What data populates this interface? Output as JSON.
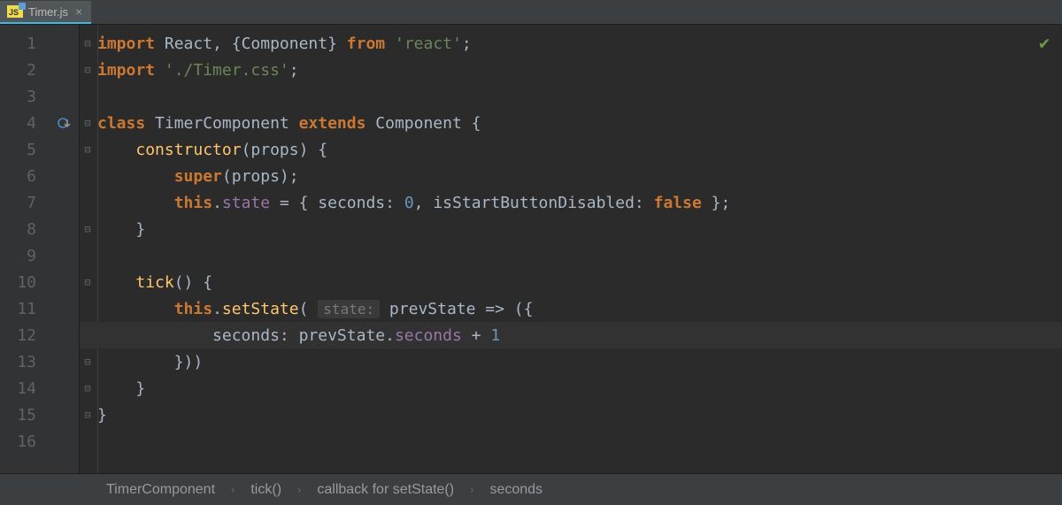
{
  "tab": {
    "filename": "Timer.js",
    "iconLabel": "JS"
  },
  "gutter": {
    "lineNumbers": [
      "1",
      "2",
      "3",
      "4",
      "5",
      "6",
      "7",
      "8",
      "9",
      "10",
      "11",
      "12",
      "13",
      "14",
      "15",
      "16"
    ]
  },
  "code": {
    "l1": {
      "kw1": "import",
      "t1": " React, {Component} ",
      "kw2": "from",
      "t2": " ",
      "s1": "'react'",
      "t3": ";"
    },
    "l2": {
      "kw1": "import",
      "t1": " ",
      "s1": "'./Timer.css'",
      "t2": ";"
    },
    "l4": {
      "kw1": "class",
      "t1": " TimerComponent ",
      "kw2": "extends",
      "t2": " Component {"
    },
    "l5": {
      "pad": "    ",
      "m1": "constructor",
      "t1": "(props) {"
    },
    "l6": {
      "pad": "        ",
      "kw1": "super",
      "t1": "(props);"
    },
    "l7": {
      "pad": "        ",
      "kw1": "this",
      "t1": ".",
      "f1": "state",
      "t2": " = { ",
      "k1": "seconds",
      "t3": ": ",
      "n1": "0",
      "t4": ", isStartButtonDisabled: ",
      "kw2": "false",
      "t5": " };"
    },
    "l8": {
      "pad": "    ",
      "t1": "}"
    },
    "l10": {
      "pad": "    ",
      "m1": "tick",
      "t1": "() {"
    },
    "l11": {
      "pad": "        ",
      "kw1": "this",
      "t1": ".",
      "m1": "setState",
      "t2": "( ",
      "hint": "state:",
      "t3": " prevState => ({"
    },
    "l12": {
      "pad": "            ",
      "k1": "seconds",
      "t1": ": prevState.",
      "f1": "seconds",
      "t2": " + ",
      "n1": "1"
    },
    "l13": {
      "pad": "        ",
      "t1": "}))"
    },
    "l14": {
      "pad": "    ",
      "t1": "}"
    },
    "l15": {
      "t1": "}"
    }
  },
  "breadcrumb": {
    "items": [
      "TimerComponent",
      "tick()",
      "callback for setState()",
      "seconds"
    ]
  }
}
